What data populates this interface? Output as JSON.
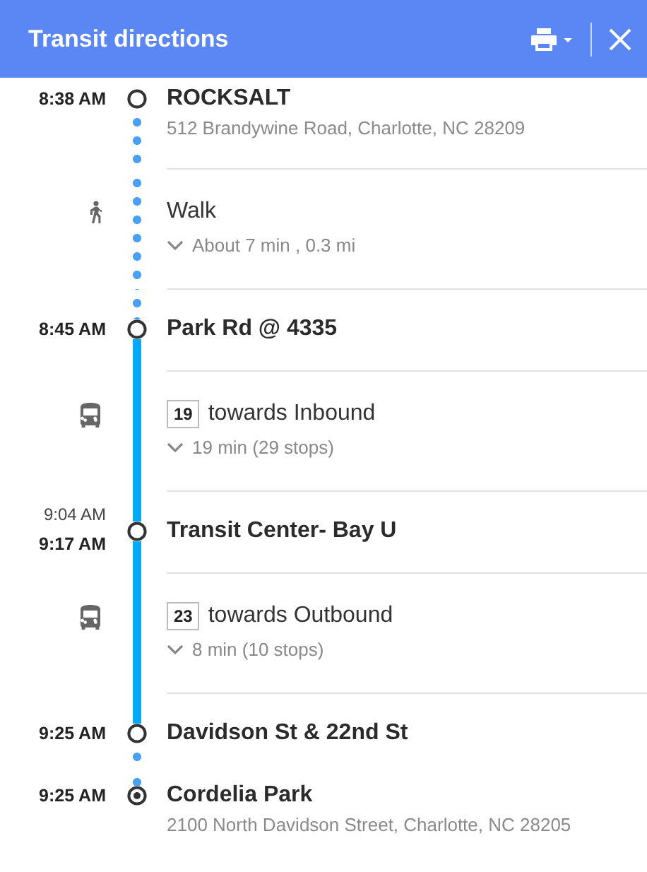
{
  "window": {
    "title": "Transit directions"
  },
  "steps": [
    {
      "kind": "stop",
      "times": [
        {
          "label": "8:38 AM",
          "kind": "main"
        }
      ],
      "name": "ROCKSALT",
      "address": "512 Brandywine Road, Charlotte, NC 28209",
      "marker": {
        "kind": "circle"
      }
    },
    {
      "kind": "leg",
      "mode": {
        "kind": "walk"
      },
      "title": "Walk",
      "detail": "About 7 min , 0.3 mi",
      "expanded": false
    },
    {
      "kind": "stop",
      "times": [
        {
          "label": "8:45 AM",
          "kind": "main"
        }
      ],
      "name": "Park Rd @ 4335",
      "marker": {
        "kind": "circle"
      }
    },
    {
      "kind": "leg",
      "mode": {
        "kind": "bus"
      },
      "route": "19",
      "title": "towards Inbound",
      "detail": "19 min (29 stops)",
      "expanded": false
    },
    {
      "kind": "stop",
      "times": [
        {
          "label": "9:04 AM",
          "kind": "minor"
        },
        {
          "label": "9:17 AM",
          "kind": "main"
        }
      ],
      "name": "Transit Center- Bay U",
      "marker": {
        "kind": "circle"
      }
    },
    {
      "kind": "leg",
      "mode": {
        "kind": "bus"
      },
      "route": "23",
      "title": "towards Outbound",
      "detail": "8 min (10 stops)",
      "expanded": false
    },
    {
      "kind": "stop",
      "times": [
        {
          "label": "9:25 AM",
          "kind": "main"
        }
      ],
      "name": "Davidson St & 22nd St",
      "marker": {
        "kind": "circle"
      }
    },
    {
      "kind": "stop",
      "times": [
        {
          "label": "9:25 AM",
          "kind": "main"
        }
      ],
      "name": "Cordelia Park",
      "address": "2100 North Davidson Street, Charlotte, NC 28205",
      "marker": {
        "kind": "destination"
      }
    }
  ]
}
